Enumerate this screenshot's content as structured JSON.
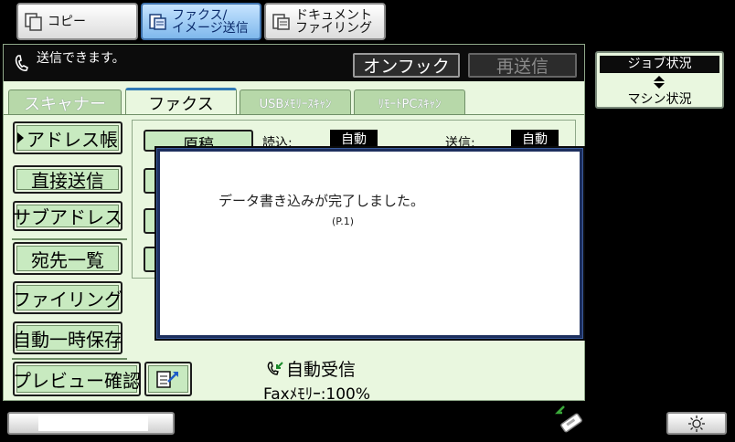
{
  "mode_tabs": [
    {
      "line1": "コピー",
      "line2": ""
    },
    {
      "line1": "ファクス/",
      "line2": "イメージ送信"
    },
    {
      "line1": "ドキュメント",
      "line2": "ファイリング"
    }
  ],
  "status": {
    "message": "送信できます。",
    "onhook_label": "オンフック",
    "resend_label": "再送信"
  },
  "func_tabs": [
    "スキャナー",
    "ファクス",
    "USBﾒﾓﾘｰｽｷｬﾝ",
    "ﾘﾓｰﾄPCｽｷｬﾝ"
  ],
  "left_buttons": {
    "address_book": "アドレス帳",
    "direct_send": "直接送信",
    "sub_address": "サブアドレス",
    "destination_list": "宛先一覧",
    "filing": "ファイリング",
    "auto_temp_save": "自動一時保存",
    "preview_confirm": "プレビュー確認"
  },
  "settings": {
    "original_label": "原稿",
    "read_label": "読込:",
    "read_value": "自動",
    "send_label": "送信:",
    "send_value": "自動"
  },
  "dialog": {
    "message": "データ書き込みが完了しました。",
    "page": "(P.1)"
  },
  "footer": {
    "auto_receive": "自動受信",
    "fax_memory": "Faxﾒﾓﾘｰ:100%"
  },
  "job_status": {
    "top_label": "ジョブ状況",
    "bottom_label": "マシン状況"
  }
}
